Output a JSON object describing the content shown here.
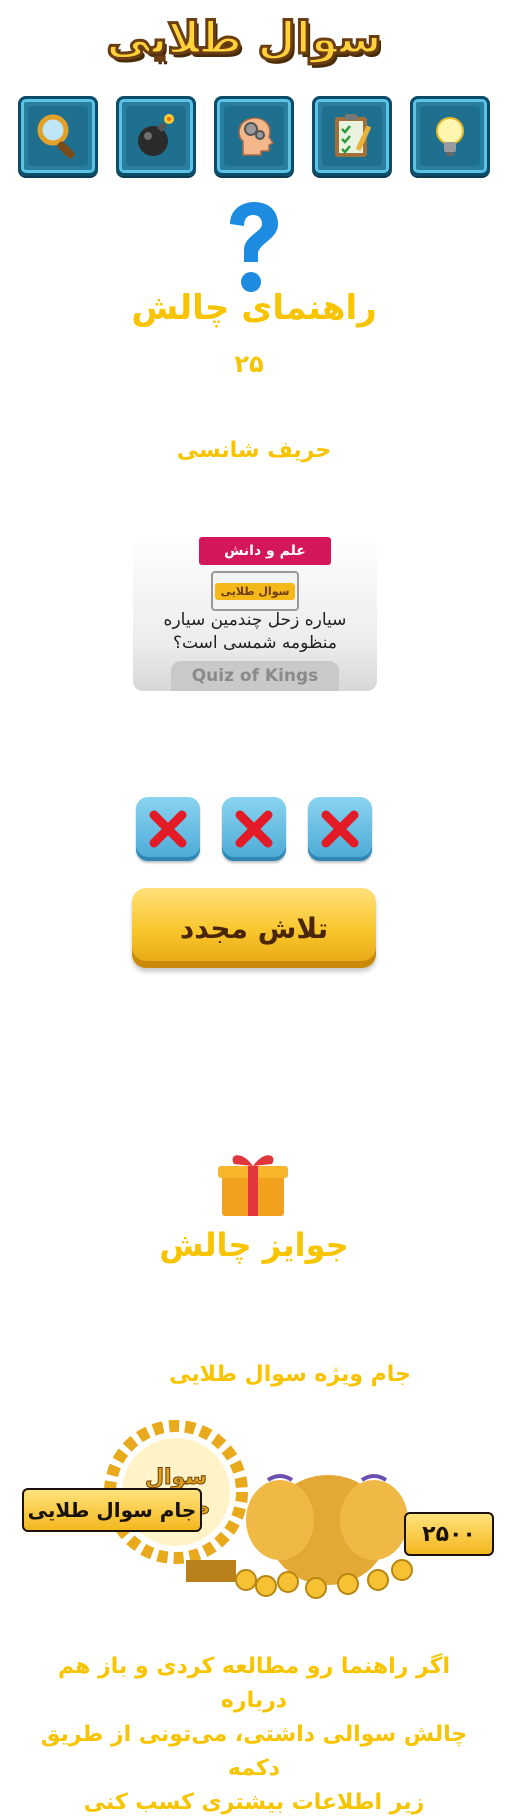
{
  "header": {
    "logo_text": "سوال طلایی"
  },
  "icons": [
    {
      "name": "magnifier-icon"
    },
    {
      "name": "bomb-icon"
    },
    {
      "name": "brain-gears-icon"
    },
    {
      "name": "clipboard-checklist-icon"
    },
    {
      "name": "lightbulb-icon"
    }
  ],
  "challenge": {
    "title": "راهنمای چالش",
    "number": "۲۵",
    "opponent": "حریف شانسی"
  },
  "card": {
    "category": "علم و دانش",
    "badge": "سوال طلایی",
    "question_line1": "سیاره زحل چندمین سیاره",
    "question_line2": "منظومه شمسی است؟",
    "brand": "Quiz of Kings"
  },
  "attempts": [
    "wrong",
    "wrong",
    "wrong"
  ],
  "retry_label": "تلاش مجدد",
  "prizes": {
    "title": "جوایز چالش",
    "cup_title": "جام ویژه سوال طلایی",
    "laurel_text": "سوال طلایی",
    "cup_label": "جام سوال طلایی",
    "amount": "۲۵۰۰"
  },
  "footer": {
    "line1": "اگر راهنما رو مطالعه کردی و باز هم درباره",
    "line2": "چالش سوالی داشتی، می‌تونی از طریق دکمه",
    "line3": "زیر اطلاعات بیشتری کسب کنی"
  },
  "colors": {
    "accent": "#f8c400",
    "card_category": "#d3175a",
    "tile": "#2a7fa0"
  }
}
